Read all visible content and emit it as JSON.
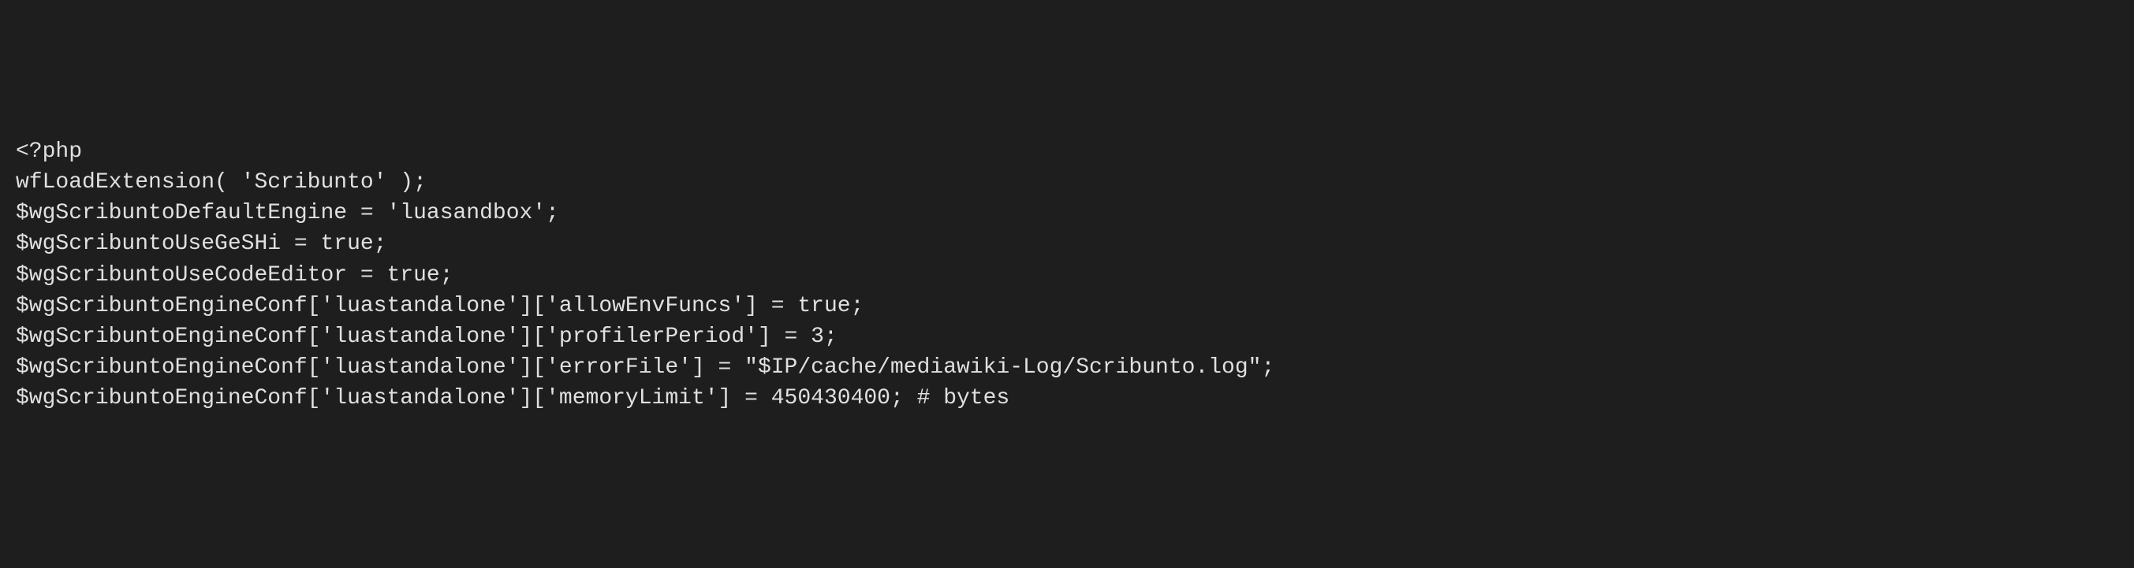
{
  "code": {
    "lines": [
      "<?php",
      "wfLoadExtension( 'Scribunto' );",
      "$wgScribuntoDefaultEngine = 'luasandbox';",
      "$wgScribuntoUseGeSHi = true;",
      "$wgScribuntoUseCodeEditor = true;",
      "$wgScribuntoEngineConf['luastandalone']['allowEnvFuncs'] = true;",
      "$wgScribuntoEngineConf['luastandalone']['profilerPeriod'] = 3;",
      "$wgScribuntoEngineConf['luastandalone']['errorFile'] = \"$IP/cache/mediawiki-Log/Scribunto.log\";",
      "$wgScribuntoEngineConf['luastandalone']['memoryLimit'] = 450430400; # bytes"
    ]
  }
}
